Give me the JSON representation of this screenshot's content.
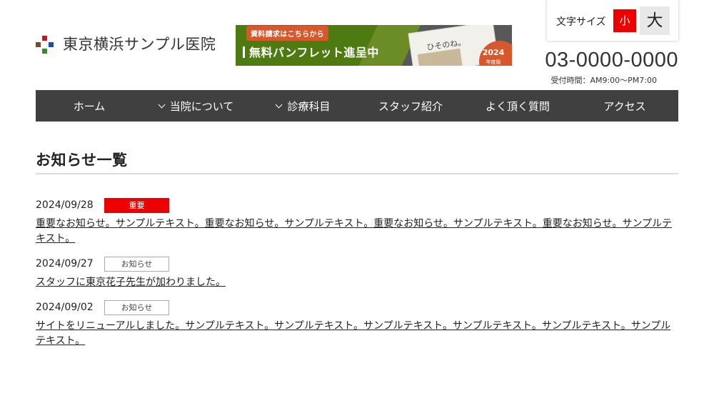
{
  "header": {
    "site_name": "東京横浜サンプル医院",
    "logo_colors": [
      "#c8161d",
      "#7a4b2a",
      "#1d4fa8",
      "#3a8a2e"
    ],
    "banner": {
      "tag": "資料請求はこちらから",
      "main_text": "無料パンフレット進呈中",
      "pamphlet_title": "ひそのね。",
      "year": "2024",
      "year_sub": "年度版"
    },
    "font_size": {
      "label": "文字サイズ",
      "small": "小",
      "large": "大",
      "selected": "small"
    },
    "phone": "03-0000-0000",
    "hours": "受付時間：AM9:00〜PM7:00"
  },
  "nav": {
    "items": [
      {
        "label": "ホーム",
        "has_dropdown": false
      },
      {
        "label": "当院について",
        "has_dropdown": true
      },
      {
        "label": "診療科目",
        "has_dropdown": true
      },
      {
        "label": "スタッフ紹介",
        "has_dropdown": false
      },
      {
        "label": "よく頂く質問",
        "has_dropdown": false
      },
      {
        "label": "アクセス",
        "has_dropdown": false
      }
    ]
  },
  "main": {
    "title": "お知らせ一覧",
    "news": [
      {
        "date": "2024/09/28",
        "category": "重要",
        "type": "important",
        "text": "重要なお知らせ。サンプルテキスト。重要なお知らせ。サンプルテキスト。重要なお知らせ。サンプルテキスト。重要なお知らせ。サンプルテキスト。"
      },
      {
        "date": "2024/09/27",
        "category": "お知らせ",
        "type": "notice",
        "text": "スタッフに東京花子先生が加わりました。"
      },
      {
        "date": "2024/09/02",
        "category": "お知らせ",
        "type": "notice",
        "text": "サイトをリニューアルしました。サンプルテキスト。サンプルテキスト。サンプルテキスト。サンプルテキスト。サンプルテキスト。サンプルテキスト。"
      }
    ]
  },
  "colors": {
    "accent_red": "#ee0000",
    "nav_bg": "#404040",
    "banner_green": "#4e7a12",
    "banner_orange": "#d8582b"
  }
}
